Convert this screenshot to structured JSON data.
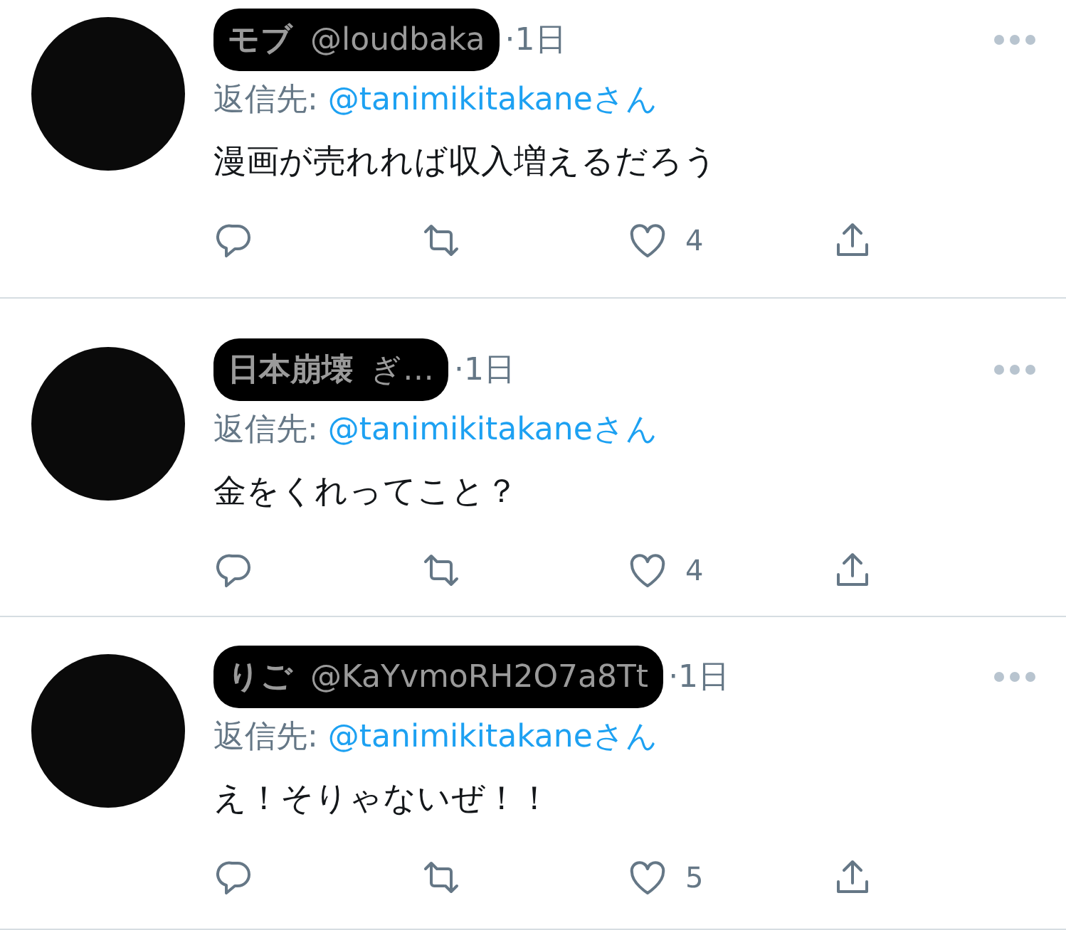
{
  "tweets": [
    {
      "name": "モブ",
      "handle": "@loudbaka",
      "time": "·1日",
      "redacted": true,
      "reply_label": "返信先:",
      "reply_to": "@tanimikitakaneさん",
      "text": "漫画が売れれば収入増えるだろう",
      "likes": "4"
    },
    {
      "name": "日本崩壊",
      "handle": "ぎ…",
      "time": "·1日",
      "redacted": true,
      "reply_label": "返信先:",
      "reply_to": "@tanimikitakaneさん",
      "text": "金をくれってこと？",
      "likes": "4"
    },
    {
      "name": "りご",
      "handle": "@KaYvmoRH2O7a8Tt",
      "time": "·1日",
      "redacted": true,
      "reply_label": "返信先:",
      "reply_to": "@tanimikitakaneさん",
      "text": "え！そりゃないぜ！！",
      "likes": "5"
    }
  ]
}
